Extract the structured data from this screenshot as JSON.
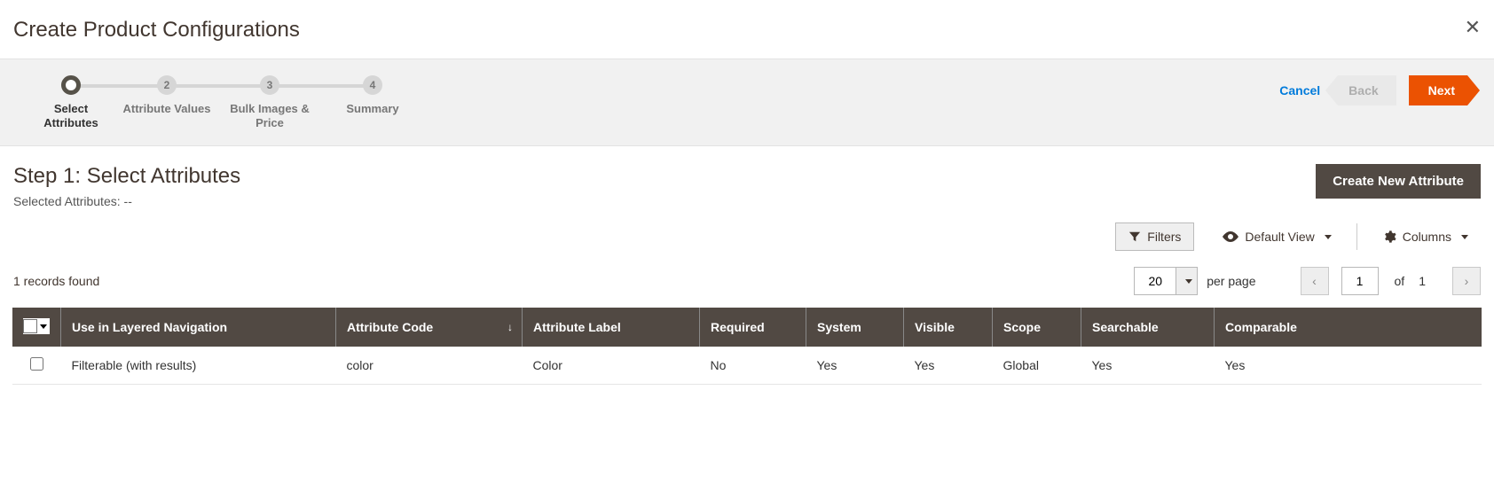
{
  "modal": {
    "title": "Create Product Configurations"
  },
  "wizard": {
    "steps": [
      {
        "label": "Select Attributes"
      },
      {
        "label": "Attribute Values"
      },
      {
        "label": "Bulk Images & Price"
      },
      {
        "label": "Summary"
      }
    ],
    "actions": {
      "cancel": "Cancel",
      "back": "Back",
      "next": "Next"
    }
  },
  "step": {
    "heading": "Step 1: Select Attributes",
    "selected_label": "Selected Attributes:",
    "selected_value": "--",
    "create_btn": "Create New Attribute"
  },
  "toolbar": {
    "filters": "Filters",
    "default_view": "Default View",
    "columns": "Columns"
  },
  "pager": {
    "records": "1 records found",
    "per_page_value": "20",
    "per_page_label": "per page",
    "page_value": "1",
    "of_label": "of",
    "total_pages": "1"
  },
  "grid": {
    "headers": {
      "layered_nav": "Use in Layered Navigation",
      "attr_code": "Attribute Code",
      "attr_label": "Attribute Label",
      "required": "Required",
      "system": "System",
      "visible": "Visible",
      "scope": "Scope",
      "searchable": "Searchable",
      "comparable": "Comparable"
    },
    "rows": [
      {
        "layered_nav": "Filterable (with results)",
        "attr_code": "color",
        "attr_label": "Color",
        "required": "No",
        "system": "Yes",
        "visible": "Yes",
        "scope": "Global",
        "searchable": "Yes",
        "comparable": "Yes"
      }
    ]
  }
}
